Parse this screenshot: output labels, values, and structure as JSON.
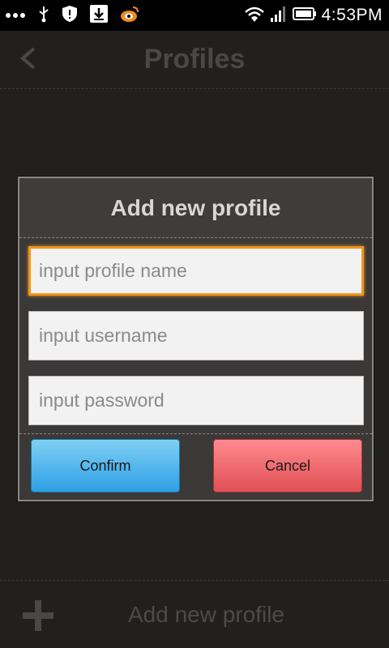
{
  "status_bar": {
    "time": "4:53PM",
    "icons": [
      "more-dots-icon",
      "usb-icon",
      "shield-icon",
      "download-icon",
      "weibo-icon",
      "wifi-icon",
      "signal-icon",
      "battery-icon"
    ]
  },
  "header": {
    "back_icon": "chevron-left-icon",
    "title": "Profiles"
  },
  "dialog": {
    "title": "Add new profile",
    "fields": [
      {
        "placeholder": "input profile name",
        "value": ""
      },
      {
        "placeholder": "input username",
        "value": ""
      },
      {
        "placeholder": "input password",
        "value": ""
      }
    ],
    "confirm_label": "Confirm",
    "cancel_label": "Cancel"
  },
  "footer": {
    "add_icon": "plus-icon",
    "label": "Add new profile"
  },
  "colors": {
    "background": "#221f1f",
    "dialog_bg": "#3b3838",
    "focus_accent": "#f0941e",
    "confirm": "#2e9fe4",
    "cancel": "#e05055"
  }
}
